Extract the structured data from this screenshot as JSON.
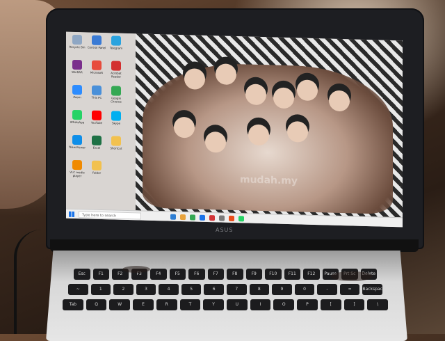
{
  "scene": {
    "description_colors": {
      "lid": "#1d1e22",
      "base": "#e6e6e6",
      "keys": "#1c1c1e",
      "taskbar": "#efefef",
      "windows_blue": "#1a73e8"
    },
    "brand_text": "ASUS",
    "watermark": "mudah.my"
  },
  "desktop": {
    "icons": [
      {
        "label": "Recycle Bin",
        "icon": "recycle-bin-icon",
        "color": "#8fa7c4"
      },
      {
        "label": "Control Panel",
        "icon": "control-panel-icon",
        "color": "#3a7bd5"
      },
      {
        "label": "Telegram",
        "icon": "telegram-icon",
        "color": "#2aa3df"
      },
      {
        "label": "WinRAR",
        "icon": "winrar-icon",
        "color": "#7a2e8c"
      },
      {
        "label": "Microsoft",
        "icon": "office-icon",
        "color": "#e74c3c"
      },
      {
        "label": "Acrobat Reader",
        "icon": "acrobat-icon",
        "color": "#d32f2f"
      },
      {
        "label": "Zoom",
        "icon": "zoom-icon",
        "color": "#2d8cff"
      },
      {
        "label": "This PC",
        "icon": "this-pc-icon",
        "color": "#4a90d9"
      },
      {
        "label": "Google Chrome",
        "icon": "chrome-icon",
        "color": "#34a853"
      },
      {
        "label": "WhatsApp",
        "icon": "whatsapp-icon",
        "color": "#25d366"
      },
      {
        "label": "YouTube",
        "icon": "youtube-icon",
        "color": "#ff0000"
      },
      {
        "label": "Skype",
        "icon": "skype-icon",
        "color": "#00aff0"
      },
      {
        "label": "TeamViewer",
        "icon": "teamviewer-icon",
        "color": "#0e8ee9"
      },
      {
        "label": "Excel",
        "icon": "excel-icon",
        "color": "#1e7145"
      },
      {
        "label": "Shortcut",
        "icon": "folder-icon",
        "color": "#f2c14e"
      },
      {
        "label": "VLC media player",
        "icon": "vlc-icon",
        "color": "#f08a00"
      },
      {
        "label": "Folder",
        "icon": "folder-icon",
        "color": "#f2c14e"
      }
    ]
  },
  "taskbar": {
    "search_placeholder": "Type here to search",
    "apps": [
      "#2d7dd2",
      "#e8a33d",
      "#34a853",
      "#1a73e8",
      "#d13438",
      "#7a7a7a",
      "#e94e1b",
      "#25d366"
    ],
    "tray": ""
  },
  "keyboard": {
    "row_fn": [
      "Esc",
      "F1",
      "F2",
      "F3",
      "F4",
      "F5",
      "F6",
      "F7",
      "F8",
      "F9",
      "F10",
      "F11",
      "F12",
      "Pause",
      "Prt Sc",
      "Delete"
    ],
    "row_num": [
      "~",
      "1",
      "2",
      "3",
      "4",
      "5",
      "6",
      "7",
      "8",
      "9",
      "0",
      "-",
      "=",
      "Backspace"
    ],
    "row_q": [
      "Tab",
      "Q",
      "W",
      "E",
      "R",
      "T",
      "Y",
      "U",
      "I",
      "O",
      "P",
      "[",
      "]",
      "\\"
    ]
  }
}
